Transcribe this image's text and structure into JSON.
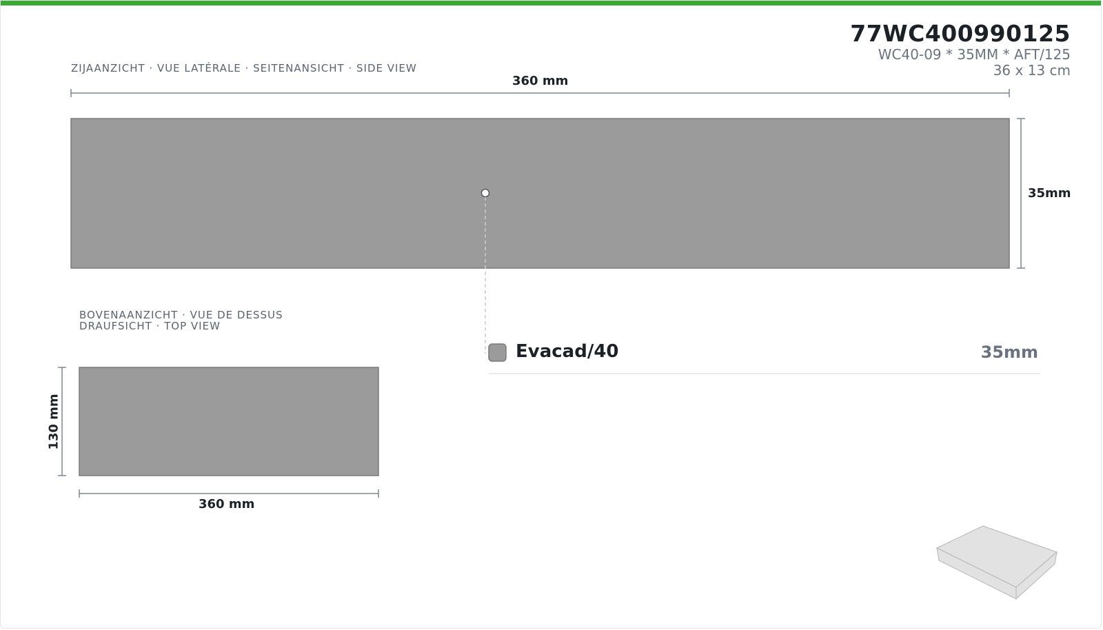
{
  "colors": {
    "accent": "#3aa935",
    "material": "#9b9b9b",
    "material_stroke": "#7a7a7a",
    "dimension_line": "#7d8592",
    "iso_face": "#e2e2e2",
    "iso_stroke": "#b5b5b5"
  },
  "header": {
    "code": "77WC400990125",
    "description": "WC40-09 * 35MM * AFT/125",
    "size": "36 x 13 cm"
  },
  "side_view": {
    "label": "ZIJAANZICHT · VUE LATÉRALE · SEITENANSICHT · SIDE VIEW",
    "width_label": "360 mm",
    "height_label": "35mm"
  },
  "top_view": {
    "label_line1": "BOVENAANZICHT · VUE DE DESSUS",
    "label_line2": "DRAUFSICHT · TOP VIEW",
    "width_label": "360 mm",
    "depth_label": "130 mm"
  },
  "layers": [
    {
      "name": "Evacad/40",
      "thickness": "35mm"
    }
  ],
  "icons": {
    "iso_preview": "isometric-board-icon",
    "layer_swatch": "material-swatch-icon",
    "layer_marker": "layer-marker-dot"
  }
}
